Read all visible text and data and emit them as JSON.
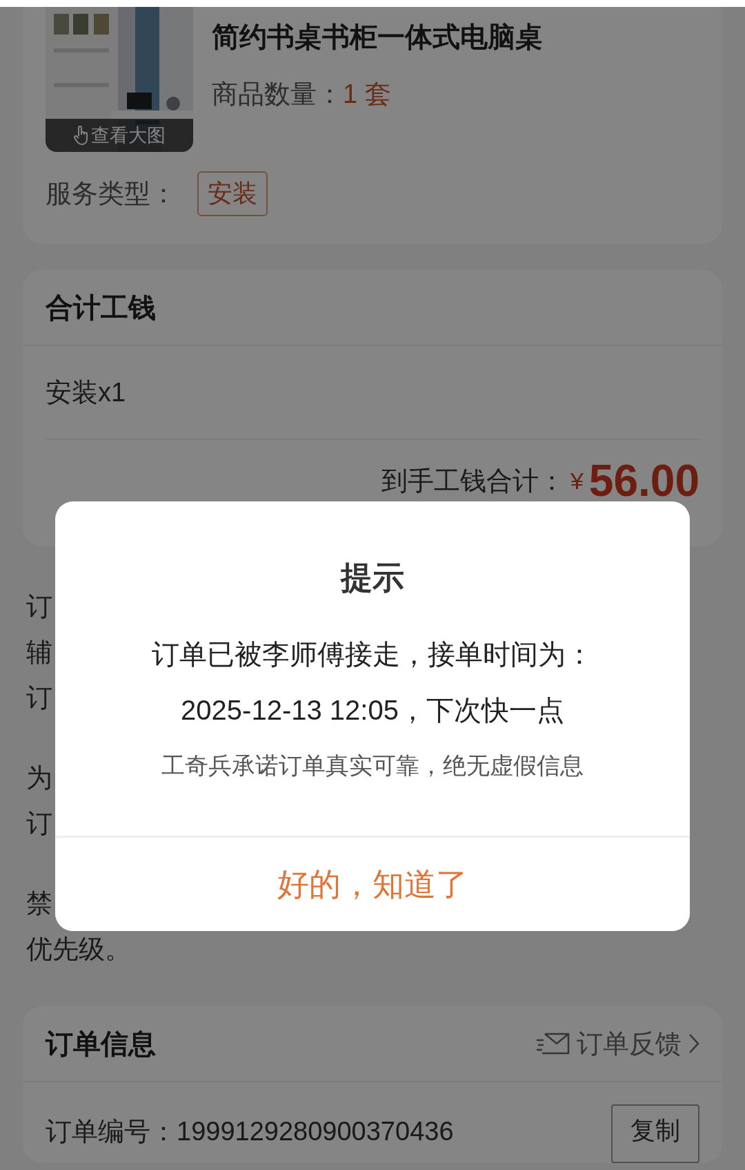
{
  "product": {
    "name": "简约书桌书柜一体式电脑桌",
    "quantity_label": "商品数量：",
    "quantity": "1 套",
    "view_image": "查看大图",
    "service_label": "服务类型：",
    "service_tag": "安装"
  },
  "wages": {
    "title": "合计工钱",
    "items": [
      "安装x1"
    ],
    "total_label": "到手工钱合计：",
    "currency": "¥",
    "total": "56.00"
  },
  "notice_paragraphs": [
    [
      "订",
      "辅",
      "订"
    ],
    [
      "为",
      "订"
    ],
    [
      "禁",
      "优先级。"
    ]
  ],
  "order_info": {
    "title": "订单信息",
    "feedback": "订单反馈",
    "number_label": "订单编号：",
    "number": "1999129280900370436",
    "copy": "复制"
  },
  "dialog": {
    "title": "提示",
    "lines": [
      "订单已被李师傅接走，接单时间为：",
      "2025-12-13 12:05，下次快一点"
    ],
    "note": "工奇兵承诺订单真实可靠，绝无虚假信息",
    "button": "好的，知道了"
  }
}
